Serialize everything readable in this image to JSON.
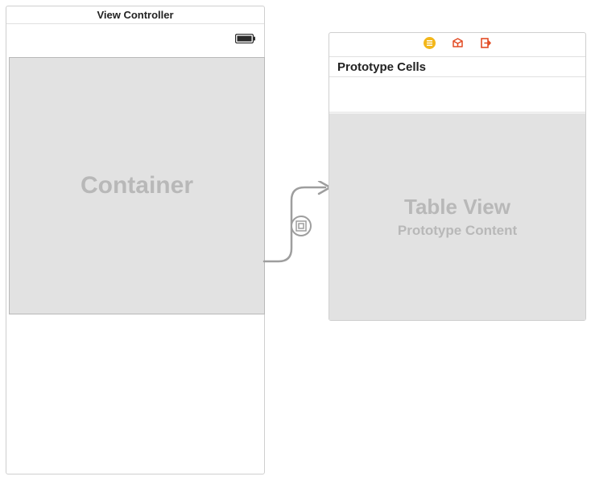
{
  "left_scene": {
    "title": "View Controller",
    "container_label": "Container"
  },
  "right_scene": {
    "prototype_header": "Prototype Cells",
    "tableview_label": "Table View",
    "tableview_sublabel": "Prototype Content"
  }
}
